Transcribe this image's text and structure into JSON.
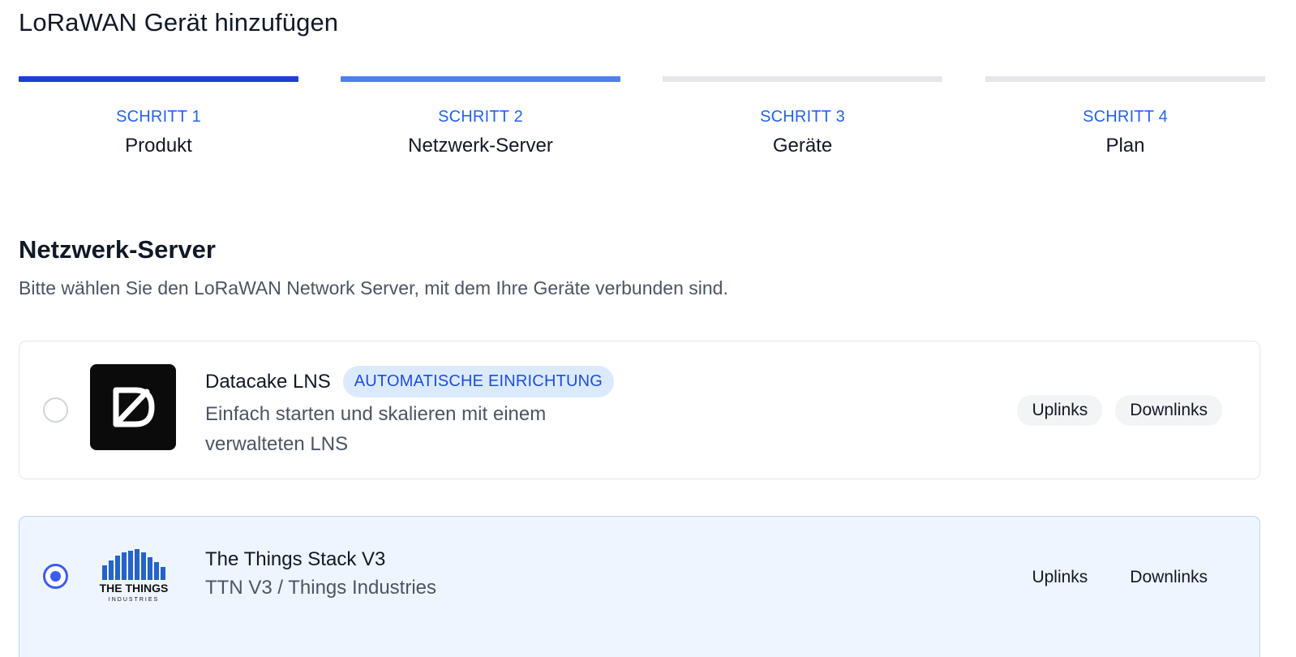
{
  "page": {
    "title": "LoRaWAN Gerät hinzufügen"
  },
  "steps": [
    {
      "number": "SCHRITT 1",
      "label": "Produkt"
    },
    {
      "number": "SCHRITT 2",
      "label": "Netzwerk-Server"
    },
    {
      "number": "SCHRITT 3",
      "label": "Geräte"
    },
    {
      "number": "SCHRITT 4",
      "label": "Plan"
    }
  ],
  "section": {
    "title": "Netzwerk-Server",
    "description": "Bitte wählen Sie den LoRaWAN Network Server, mit dem Ihre Geräte verbunden sind."
  },
  "servers": [
    {
      "name": "Datacake LNS",
      "badge": "AUTOMATISCHE EINRICHTUNG",
      "description": "Einfach starten und skalieren mit einem verwalteten LNS",
      "tags": [
        "Uplinks",
        "Downlinks"
      ],
      "selected": false,
      "logo_icon": "datacake-logo-icon"
    },
    {
      "name": "The Things Stack V3",
      "description": "TTN V3 / Things Industries",
      "logo_text_line1": "THE THINGS",
      "logo_text_line2": "INDUSTRIES",
      "tags": [
        "Uplinks",
        "Downlinks"
      ],
      "selected": true,
      "logo_icon": "the-things-industries-logo-icon"
    }
  ],
  "colors": {
    "step_active": "#1d3fd6",
    "step_current": "#4f7ff0",
    "step_inactive": "#e5e7eb",
    "accent": "#2563eb",
    "radio_selected": "#3b5bf5",
    "card_selected_bg": "#eef5fe"
  }
}
